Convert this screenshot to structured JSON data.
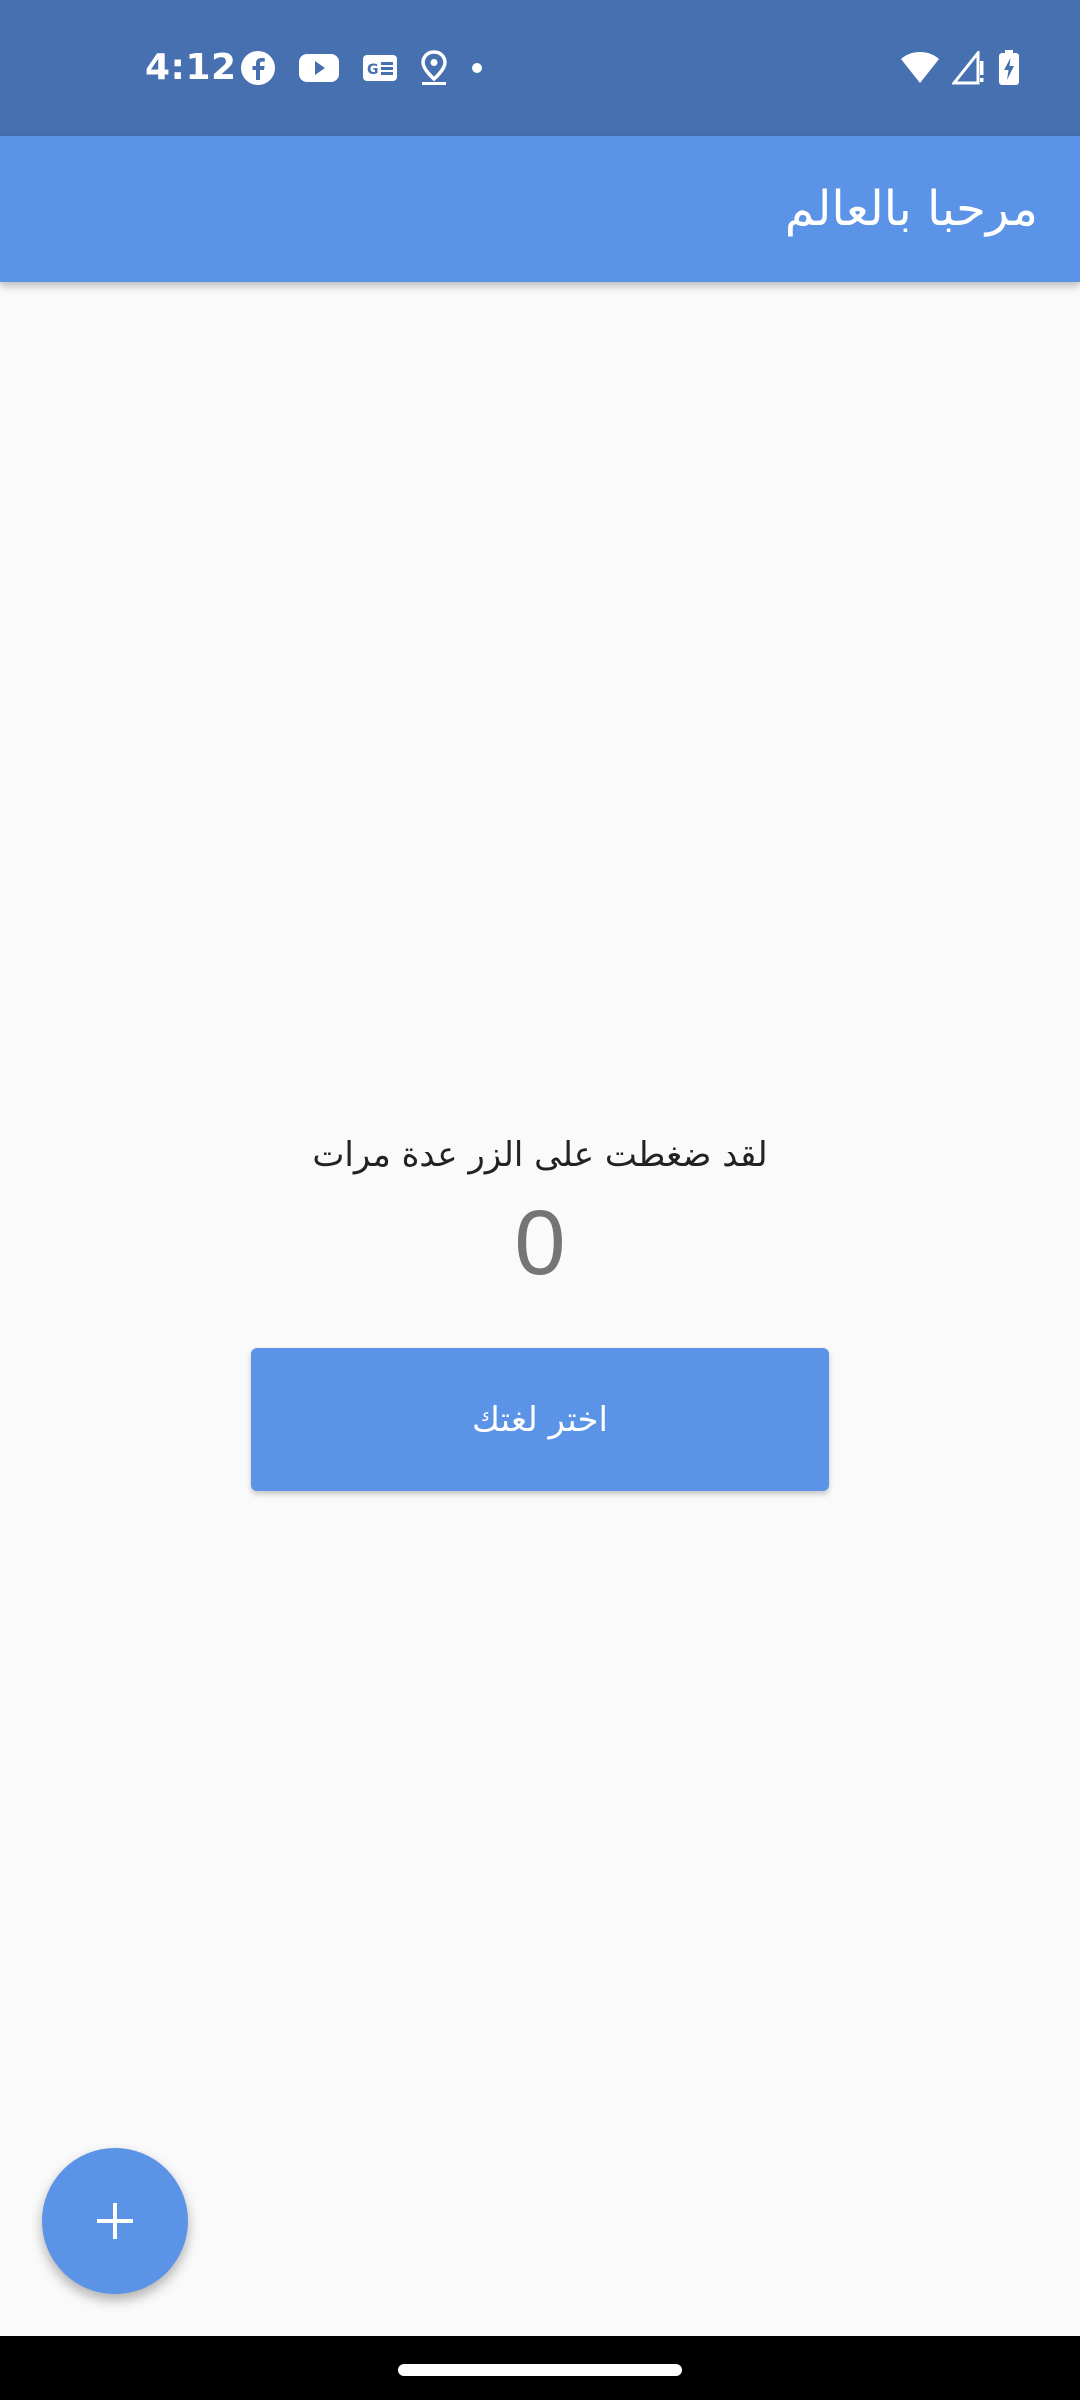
{
  "status_bar": {
    "time": "4:12",
    "left_icons": [
      "facebook-icon",
      "youtube-icon",
      "news-icon",
      "location-icon",
      "dot-icon"
    ],
    "right_icons": [
      "wifi-icon",
      "signal-icon",
      "battery-charging-icon"
    ]
  },
  "app_bar": {
    "title": "مرحبا بالعالم"
  },
  "main": {
    "counter_label": "لقد ضغطت على الزر عدة مرات",
    "counter_value": "0",
    "language_button_label": "اختر لغتك"
  },
  "fab": {
    "icon": "plus-icon"
  },
  "colors": {
    "status_bar": "#4670b0",
    "primary": "#5b93e6",
    "background": "#fafafa",
    "counter_text": "#757575"
  }
}
